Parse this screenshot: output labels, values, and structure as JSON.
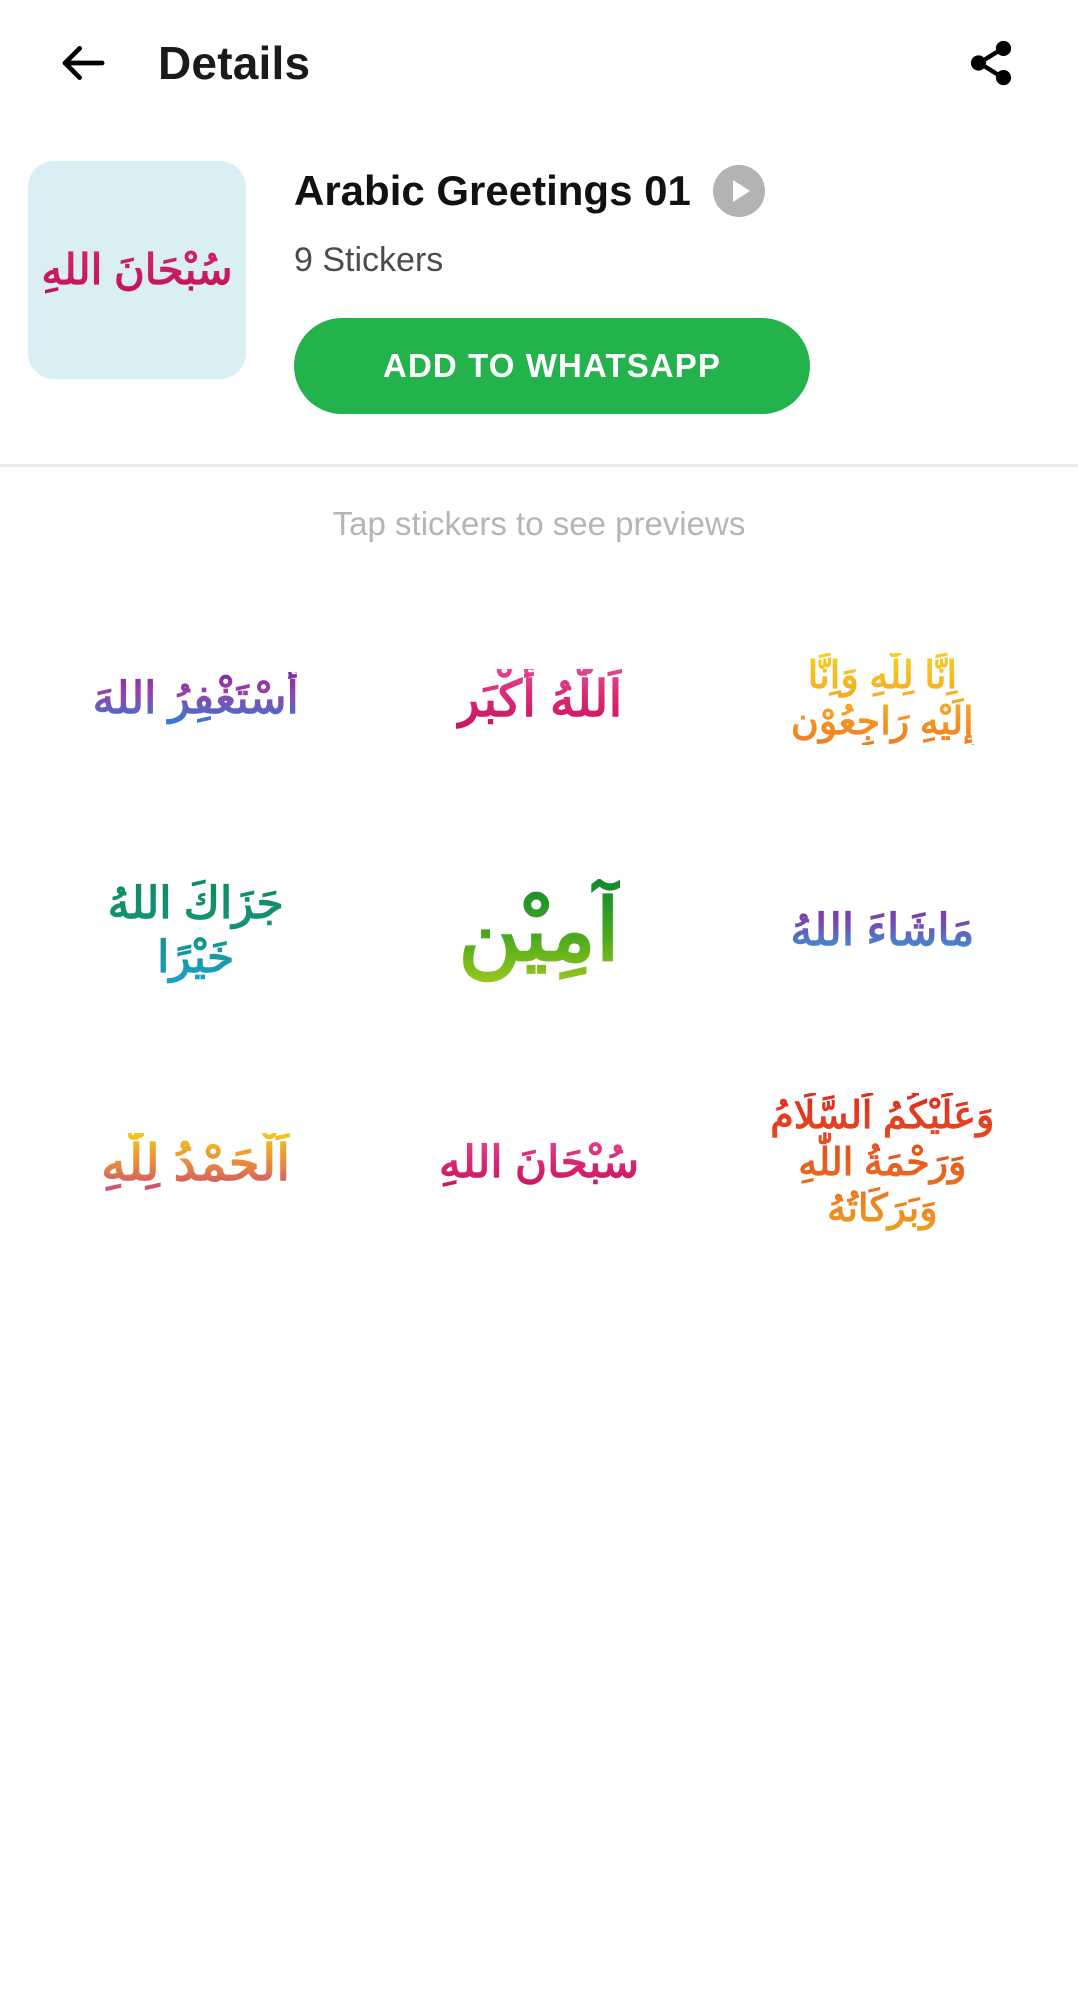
{
  "toolbar": {
    "back_icon": "arrow-left-icon",
    "title": "Details",
    "share_icon": "share-icon"
  },
  "pack": {
    "tray_art_text": "سُبْحَانَ اللهِ",
    "tray_background_color": "#d9eff5",
    "title": "Arabic Greetings 01",
    "play_icon": "play-icon",
    "sticker_count_label": "9 Stickers",
    "add_button_label": "ADD TO WHATSAPP",
    "add_button_color": "#23b24b"
  },
  "hint": {
    "text": "Tap stickers to see previews",
    "color": "#b5b5b5"
  },
  "stickers": [
    {
      "text": "أَسْتَغْفِرُ اللهَ",
      "gradient_class": "g-purple-blue",
      "size_class": "sz-m",
      "colors": "#7b2f9e → #2a7fd4"
    },
    {
      "text": "اَللّٰهُ أَكْبَر",
      "gradient_class": "g-pink",
      "size_class": "sz-l",
      "colors": "#e0478f → #c8145e"
    },
    {
      "text": "اِنَّا لِلّٰهِ وَاِنَّا\nإِلَيْهِ رَاجِعُوْن",
      "gradient_class": "g-yellow-orng",
      "size_class": "sz-s",
      "colors": "#f5d020 → #f07b22"
    },
    {
      "text": "جَزَاكَ اللهُ\nخَيْرًا",
      "gradient_class": "g-green-teal",
      "size_class": "sz-m",
      "colors": "#0f8a5f → #1d9fd0"
    },
    {
      "text": "آمِيْن",
      "gradient_class": "g-green-lime",
      "size_class": "sz-xl",
      "colors": "#0f8a2f → #9ac81c"
    },
    {
      "text": "مَاشَاءَ اللهُ",
      "gradient_class": "g-purple-cyan",
      "size_class": "sz-m",
      "colors": "#8a2f9e → #26b0d8"
    },
    {
      "text": "اَلْحَمْدُ لِلّٰهِ",
      "gradient_class": "g-yellow-pink",
      "size_class": "sz-l",
      "colors": "#f2c81e → #c8447a"
    },
    {
      "text": "سُبْحَانَ اللهِ",
      "gradient_class": "g-pink",
      "size_class": "sz-m",
      "colors": "#e0478f → #c8145e"
    },
    {
      "text": "وَعَلَيْكُمُ اَلسَّلَامُ\nوَرَحْمَةُ اللّٰهِ\nوَبَرَكَاتُهُ",
      "gradient_class": "g-red-orange",
      "size_class": "sz-s",
      "colors": "#e02b20 → #efa022"
    }
  ]
}
